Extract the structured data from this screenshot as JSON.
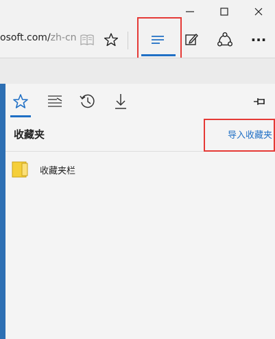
{
  "window": {
    "minimize_glyph": "—",
    "maximize_glyph": "☐",
    "close_glyph": "✕"
  },
  "toolbar": {
    "address_main": "osoft.com/",
    "address_dim": "zh-cn",
    "reading_view_icon": "book-icon",
    "favorite_icon": "star-icon",
    "hub_icon": "hub-lines-icon",
    "notes_icon": "pen-note-icon",
    "share_icon": "share-icon",
    "more_label": "···"
  },
  "hub": {
    "tabs": [
      {
        "name": "favorites",
        "icon": "star-icon",
        "active": true
      },
      {
        "name": "reading-list",
        "icon": "reading-list-icon",
        "active": false
      },
      {
        "name": "history",
        "icon": "history-icon",
        "active": false
      },
      {
        "name": "downloads",
        "icon": "download-icon",
        "active": false
      }
    ],
    "pin_icon": "pin-icon",
    "heading": "收藏夹",
    "import_link": "导入收藏夹",
    "items": [
      {
        "label": "收藏夹栏",
        "icon": "folder-icon"
      }
    ]
  },
  "colors": {
    "accent": "#1f6fc5",
    "highlight": "#e53935",
    "folder": "#f5cf3a"
  }
}
